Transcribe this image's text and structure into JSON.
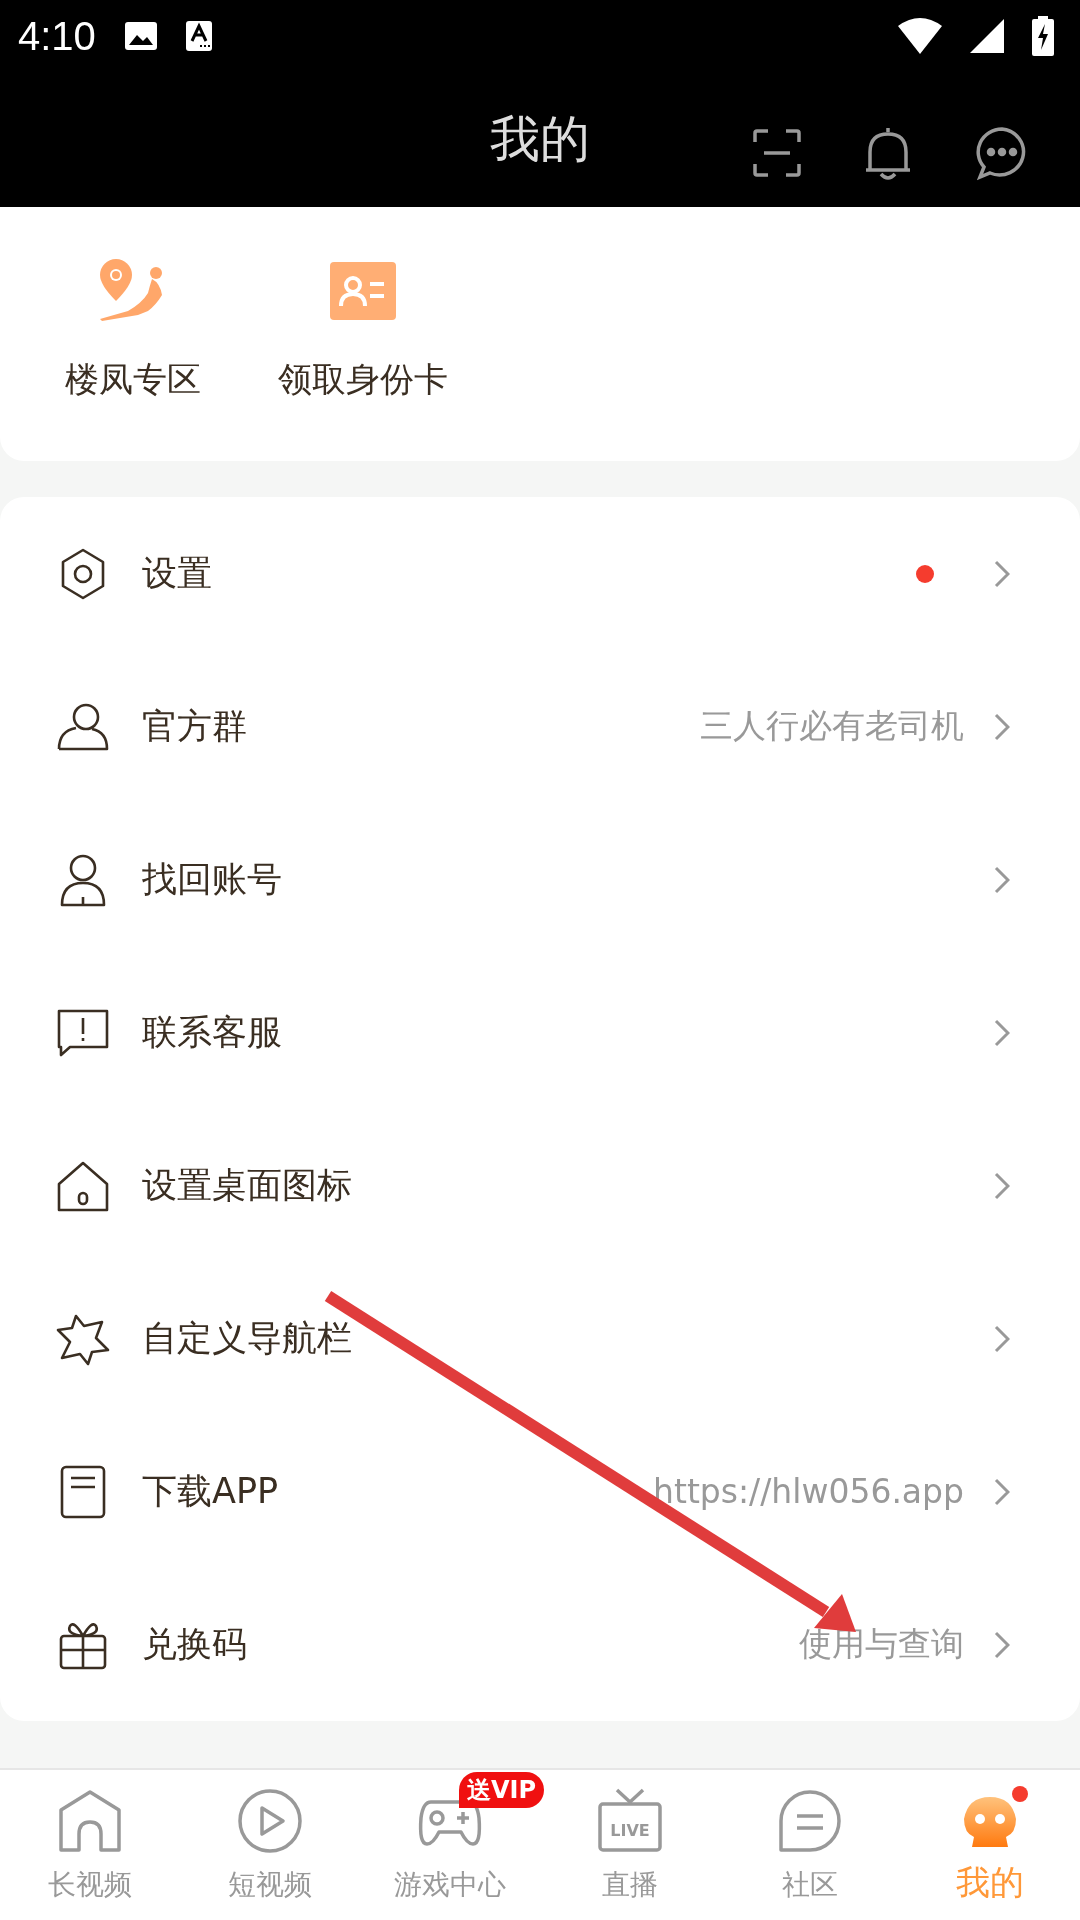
{
  "status_bar": {
    "time": "4:10"
  },
  "header": {
    "title": "我的"
  },
  "shortcuts": [
    {
      "label": "楼凤专区"
    },
    {
      "label": "领取身份卡"
    }
  ],
  "menu": [
    {
      "label": "设置",
      "dot": true
    },
    {
      "label": "官方群",
      "value": "三人行必有老司机",
      "dot": false
    },
    {
      "label": "找回账号",
      "dot": false
    },
    {
      "label": "联系客服",
      "dot": false
    },
    {
      "label": "设置桌面图标",
      "dot": false
    },
    {
      "label": "自定义导航栏",
      "dot": false
    },
    {
      "label": "下载APP",
      "value": "https://hlw056.app",
      "dot": false
    },
    {
      "label": "兑换码",
      "value": "使用与查询",
      "dot": false
    }
  ],
  "bottom_nav": [
    {
      "label": "长视频",
      "selected": false,
      "dot": false
    },
    {
      "label": "短视频",
      "selected": false,
      "dot": false
    },
    {
      "label": "游戏中心",
      "selected": false,
      "badge": "送VIP",
      "dot": false
    },
    {
      "label": "直播",
      "selected": false,
      "icon_text": "LIVE",
      "dot": false
    },
    {
      "label": "社区",
      "selected": false,
      "dot": false
    },
    {
      "label": "我的",
      "selected": true,
      "dot": true
    }
  ]
}
